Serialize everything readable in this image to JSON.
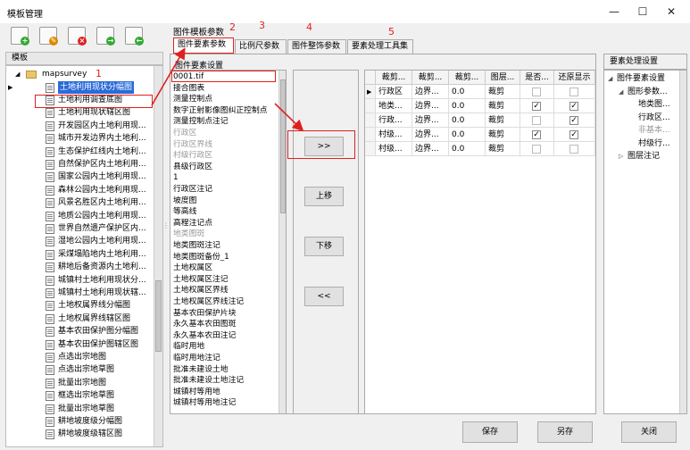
{
  "window": {
    "title": "模板管理",
    "controls": [
      "—",
      "☐",
      "✕"
    ]
  },
  "toolbar": {
    "buttons": [
      "add-template",
      "edit-template",
      "delete-template",
      "import-template",
      "export-template"
    ]
  },
  "left_panel": {
    "header": "模板",
    "root": "mapsurvey",
    "items": [
      "土地利用现状分幅图",
      "土地利用调查底图",
      "土地利用现状辖区图",
      "开发园区内土地利用现...",
      "城市开发边界内土地利...",
      "生态保护红线内土地利...",
      "自然保护区内土地利用...",
      "国家公园内土地利用现...",
      "森林公园内土地利用现...",
      "风景名胜区内土地利用...",
      "地质公园内土地利用现...",
      "世界自然遗产保护区内...",
      "湿地公园内土地利用现...",
      "采煤塌陷地内土地利用...",
      "耕地后备资源内土地利...",
      "城镇村土地利用现状分...",
      "城镇村土地利用现状辖...",
      "土地权属界线分幅图",
      "土地权属界线辖区图",
      "基本农田保护图分幅图",
      "基本农田保护图辖区图",
      "点选出宗地图",
      "点选出宗地草图",
      "批量出宗地图",
      "框选出宗地草图",
      "批量出宗地草图",
      "耕地坡度级分幅图",
      "耕地坡度级辖区图"
    ]
  },
  "group_title": "图件模板参数",
  "tabs": [
    "图件要素参数",
    "比例尺参数",
    "图件整饰参数",
    "要素处理工具集"
  ],
  "element_settings": {
    "title": "图件要素设置",
    "items": [
      {
        "t": "0001.tif",
        "g": false
      },
      {
        "t": "接合图表",
        "g": false
      },
      {
        "t": "测量控制点",
        "g": false
      },
      {
        "t": "数字正射影像图纠正控制点",
        "g": false
      },
      {
        "t": "测量控制点注记",
        "g": false
      },
      {
        "t": "行政区",
        "g": true
      },
      {
        "t": "行政区界线",
        "g": true
      },
      {
        "t": "村级行政区",
        "g": true
      },
      {
        "t": "县级行政区",
        "g": false
      },
      {
        "t": "1",
        "g": false
      },
      {
        "t": "行政区注记",
        "g": false
      },
      {
        "t": "坡度图",
        "g": false
      },
      {
        "t": "等高线",
        "g": false
      },
      {
        "t": "高程注记点",
        "g": false
      },
      {
        "t": "地类图斑",
        "g": true
      },
      {
        "t": "地类图斑注记",
        "g": false
      },
      {
        "t": "地类图斑备份_1",
        "g": false
      },
      {
        "t": "土地权属区",
        "g": false
      },
      {
        "t": "土地权属区注记",
        "g": false
      },
      {
        "t": "土地权属区界线",
        "g": false
      },
      {
        "t": "土地权属区界线注记",
        "g": false
      },
      {
        "t": "基本农田保护片块",
        "g": false
      },
      {
        "t": "永久基本农田图斑",
        "g": false
      },
      {
        "t": "永久基本农田注记",
        "g": false
      },
      {
        "t": "临时用地",
        "g": false
      },
      {
        "t": "临时用地注记",
        "g": false
      },
      {
        "t": "批准未建设土地",
        "g": false
      },
      {
        "t": "批准未建设土地注记",
        "g": false
      },
      {
        "t": "城镇村等用地",
        "g": false
      },
      {
        "t": "城镇村等用地注记",
        "g": false
      }
    ]
  },
  "move_buttons": {
    "add": ">>",
    "up": "上移",
    "down": "下移",
    "remove": "<<"
  },
  "grid": {
    "headers": [
      "裁剪...",
      "裁剪...",
      "裁剪...",
      "图层...",
      "是否...",
      "还原显示"
    ],
    "rows": [
      {
        "c1": "行政区",
        "c2": "边界...",
        "c3": "0.0",
        "c4": "裁剪",
        "chk1": false,
        "chk2": false,
        "current": true
      },
      {
        "c1": "地类...",
        "c2": "边界...",
        "c3": "0.0",
        "c4": "裁剪",
        "chk1": true,
        "chk2": true,
        "current": false
      },
      {
        "c1": "行政...",
        "c2": "边界...",
        "c3": "0.0",
        "c4": "裁剪",
        "chk1": false,
        "chk2": true,
        "current": false
      },
      {
        "c1": "村级...",
        "c2": "边界...",
        "c3": "0.0",
        "c4": "裁剪",
        "chk1": true,
        "chk2": true,
        "current": false
      },
      {
        "c1": "村级...",
        "c2": "边界...",
        "c3": "0.0",
        "c4": "裁剪",
        "chk1": false,
        "chk2": false,
        "current": false
      }
    ]
  },
  "right_panel": {
    "header": "要素处理设置",
    "nodes": [
      {
        "t": "图件要素设置",
        "lvl": 0,
        "exp": "◢"
      },
      {
        "t": "图形参数...",
        "lvl": 1,
        "exp": "◢"
      },
      {
        "t": "地类图...",
        "lvl": 2,
        "exp": ""
      },
      {
        "t": "行政区...",
        "lvl": 2,
        "exp": ""
      },
      {
        "t": "非基本...",
        "lvl": 2,
        "exp": "",
        "gray": true
      },
      {
        "t": "村级行...",
        "lvl": 2,
        "exp": ""
      },
      {
        "t": "图层注记",
        "lvl": 1,
        "exp": "▷"
      }
    ]
  },
  "bottom": {
    "save": "保存",
    "save_as": "另存",
    "close": "关闭"
  },
  "annotations": [
    "1",
    "2",
    "3",
    "4",
    "5"
  ]
}
